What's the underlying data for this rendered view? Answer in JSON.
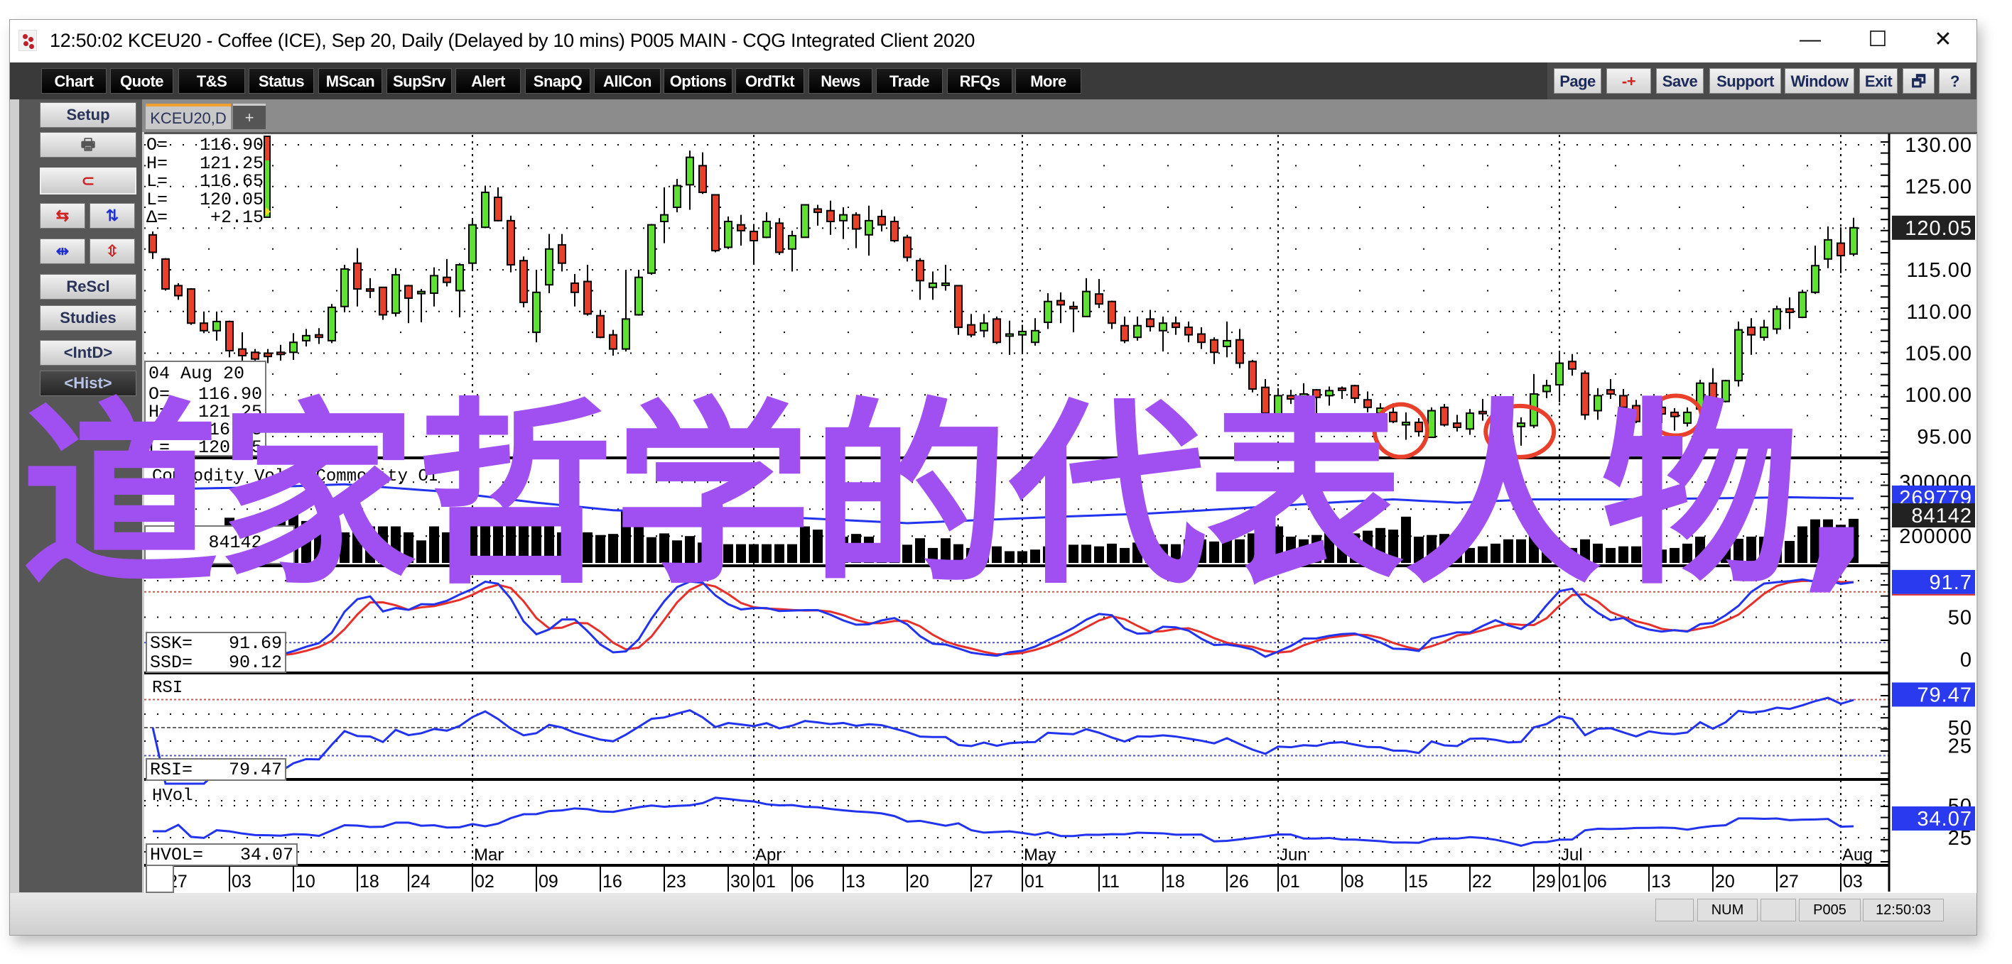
{
  "window": {
    "title": "12:50:02  KCEU20 - Coffee (ICE), Sep 20, Daily (Delayed by 10 mins)   P005 MAIN - CQG Integrated Client 2020",
    "minimize": "—",
    "maximize": "☐",
    "close": "✕"
  },
  "toolbar": {
    "left": [
      "Chart",
      "Quote",
      "T&S",
      "Status",
      "MScan",
      "SupSrv",
      "Alert",
      "SnapQ",
      "AllCon",
      "Options",
      "OrdTkt",
      "News",
      "Trade",
      "RFQs",
      "More"
    ],
    "right": [
      "Page",
      "-+",
      "Save",
      "Support",
      "Window",
      "Exit",
      "🗗",
      "?"
    ]
  },
  "sidebar": {
    "setup": "Setup",
    "print": "🖶",
    "magnet": "⊂",
    "rescl": "ReScl",
    "studies": "Studies",
    "intd": "<IntD>",
    "hist": "<Hist>",
    "arrows": [
      "⇆",
      "⇅",
      "⇹",
      "⇳"
    ]
  },
  "tabs": [
    {
      "label": "KCEU20,D"
    },
    {
      "label": "+"
    }
  ],
  "ohlc_readout": [
    {
      "k": "O=",
      "v": "116.90"
    },
    {
      "k": "H=",
      "v": "121.25"
    },
    {
      "k": "L=",
      "v": "116.65"
    },
    {
      "k": "L=",
      "v": "120.05"
    },
    {
      "k": "Δ=",
      "v": "+2.15"
    }
  ],
  "cursor_readout": {
    "date": "04 Aug 20",
    "rows": [
      {
        "k": "O=",
        "v": "116.90"
      },
      {
        "k": "H=",
        "v": "121.25"
      },
      {
        "k": "L=",
        "v": "116.65"
      },
      {
        "k": "L=",
        "v": "120.05"
      }
    ]
  },
  "panel_labels": {
    "volume": "Commodity Vol & Commodity OI",
    "vol_key": "Vol=",
    "vol_val": "84142",
    "rsi": "RSI",
    "hvol": "HVol"
  },
  "stoch_readout": [
    {
      "k": "SSK=",
      "v": "91.69"
    },
    {
      "k": "SSD=",
      "v": "90.12"
    }
  ],
  "rsi_readout": {
    "k": "RSI=",
    "v": "79.47"
  },
  "hvol_readout": {
    "k": "HVOL=",
    "v": "34.07"
  },
  "watermark": {
    "text": "道家哲学的代表人物,",
    "color": "#a050f0"
  },
  "status": {
    "num": "NUM",
    "page": "P005",
    "time": "12:50:03"
  },
  "colors": {
    "up": "#5ce22f",
    "down": "#e8402a",
    "line": "#2233ee",
    "signal": "#e8302a",
    "circle": "#e8402a"
  },
  "chart_data": {
    "type": "candlestick",
    "title": "KCEU20 - Coffee (ICE), Sep 20, Daily",
    "candles": [
      [
        119.2,
        119.6,
        116.3,
        117.1
      ],
      [
        116.3,
        116.4,
        112.5,
        112.7
      ],
      [
        113.1,
        113.4,
        111.4,
        111.9
      ],
      [
        112.7,
        112.8,
        108.4,
        108.6
      ],
      [
        108.6,
        110.0,
        107.4,
        107.7
      ],
      [
        107.7,
        110.0,
        106.5,
        108.8
      ],
      [
        108.8,
        108.9,
        104.5,
        105.3
      ],
      [
        105.5,
        107.5,
        104.0,
        104.7
      ],
      [
        105.1,
        105.5,
        103.7,
        104.3
      ],
      [
        105.0,
        105.5,
        103.8,
        104.6
      ],
      [
        105.1,
        106.0,
        104.1,
        104.9
      ],
      [
        105.1,
        107.4,
        104.2,
        106.3
      ],
      [
        106.5,
        107.9,
        105.8,
        107.1
      ],
      [
        107.2,
        108.0,
        106.1,
        106.9
      ],
      [
        106.5,
        110.9,
        106.2,
        110.5
      ],
      [
        110.6,
        115.6,
        109.9,
        115.1
      ],
      [
        115.8,
        117.6,
        110.6,
        112.7
      ],
      [
        112.7,
        114.0,
        111.6,
        112.5
      ],
      [
        112.9,
        112.9,
        109.0,
        109.6
      ],
      [
        109.8,
        115.2,
        109.4,
        114.4
      ],
      [
        113.1,
        113.2,
        108.6,
        111.6
      ],
      [
        112.2,
        112.7,
        108.7,
        112.4
      ],
      [
        112.2,
        115.3,
        110.6,
        114.3
      ],
      [
        114.1,
        116.3,
        113.0,
        113.5
      ],
      [
        112.5,
        115.8,
        109.3,
        115.6
      ],
      [
        115.8,
        121.1,
        114.9,
        120.4
      ],
      [
        120.1,
        125.1,
        120.0,
        124.3
      ],
      [
        123.7,
        124.9,
        120.8,
        120.9
      ],
      [
        120.9,
        121.5,
        114.7,
        115.6
      ],
      [
        116.1,
        116.6,
        110.5,
        111.1
      ],
      [
        107.5,
        115.0,
        106.3,
        112.3
      ],
      [
        113.2,
        119.3,
        112.2,
        117.5
      ],
      [
        118.0,
        119.3,
        114.8,
        115.8
      ],
      [
        113.4,
        114.5,
        110.6,
        112.3
      ],
      [
        113.6,
        115.6,
        109.5,
        109.7
      ],
      [
        109.5,
        110.2,
        106.8,
        106.9
      ],
      [
        107.2,
        107.8,
        104.7,
        105.5
      ],
      [
        105.5,
        115.0,
        105.2,
        109.1
      ],
      [
        109.6,
        115.0,
        109.5,
        114.1
      ],
      [
        114.6,
        120.5,
        114.4,
        120.4
      ],
      [
        120.8,
        124.9,
        118.2,
        121.6
      ],
      [
        122.5,
        125.9,
        121.9,
        125.1
      ],
      [
        125.2,
        129.3,
        122.2,
        128.5
      ],
      [
        127.5,
        129.1,
        124.1,
        124.3
      ],
      [
        124.0,
        124.0,
        117.1,
        117.3
      ],
      [
        117.7,
        121.4,
        117.5,
        120.8
      ],
      [
        120.4,
        121.6,
        117.9,
        119.7
      ],
      [
        119.6,
        120.5,
        115.8,
        118.5
      ],
      [
        118.9,
        121.9,
        118.8,
        120.8
      ],
      [
        120.6,
        121.2,
        116.8,
        117.1
      ],
      [
        117.5,
        119.7,
        114.8,
        119.1
      ],
      [
        118.9,
        122.8,
        118.9,
        122.8
      ],
      [
        122.3,
        122.8,
        120.3,
        121.9
      ],
      [
        122.1,
        123.3,
        119.2,
        120.8
      ],
      [
        120.9,
        122.5,
        118.7,
        121.6
      ],
      [
        121.6,
        121.9,
        117.6,
        119.9
      ],
      [
        119.2,
        122.7,
        116.7,
        120.9
      ],
      [
        121.4,
        122.2,
        119.6,
        120.4
      ],
      [
        120.8,
        121.4,
        118.3,
        118.5
      ],
      [
        118.9,
        119.2,
        116.0,
        116.5
      ],
      [
        116.1,
        116.4,
        111.4,
        113.7
      ],
      [
        112.9,
        114.8,
        111.4,
        113.4
      ],
      [
        113.4,
        115.6,
        112.5,
        113.4
      ],
      [
        113.1,
        113.1,
        107.2,
        108.1
      ],
      [
        108.4,
        109.7,
        106.9,
        107.2
      ],
      [
        107.7,
        109.7,
        106.9,
        108.6
      ],
      [
        109.1,
        109.4,
        106.1,
        106.3
      ],
      [
        107.2,
        108.9,
        104.8,
        107.3
      ],
      [
        107.2,
        108.4,
        104.9,
        107.6
      ],
      [
        106.3,
        109.2,
        105.9,
        107.7
      ],
      [
        108.7,
        112.2,
        107.9,
        111.2
      ],
      [
        111.3,
        112.3,
        108.6,
        110.8
      ],
      [
        110.6,
        111.2,
        107.5,
        110.5
      ],
      [
        109.4,
        114.0,
        109.4,
        112.4
      ],
      [
        112.1,
        113.9,
        110.4,
        110.9
      ],
      [
        111.2,
        111.3,
        107.9,
        108.6
      ],
      [
        108.3,
        109.4,
        106.2,
        106.5
      ],
      [
        106.9,
        109.4,
        106.5,
        108.3
      ],
      [
        109.1,
        110.2,
        107.6,
        108.2
      ],
      [
        107.7,
        109.4,
        105.2,
        108.6
      ],
      [
        108.6,
        109.4,
        107.2,
        108.1
      ],
      [
        108.1,
        108.8,
        106.3,
        107.2
      ],
      [
        107.3,
        108.1,
        105.5,
        106.3
      ],
      [
        106.6,
        106.9,
        103.7,
        105.1
      ],
      [
        105.8,
        108.8,
        104.5,
        106.5
      ],
      [
        106.6,
        107.9,
        103.2,
        103.8
      ],
      [
        104.0,
        104.2,
        100.3,
        100.7
      ],
      [
        100.9,
        101.9,
        97.6,
        97.8
      ],
      [
        97.6,
        100.8,
        96.3,
        99.9
      ],
      [
        99.9,
        100.6,
        98.9,
        99.5
      ],
      [
        100.1,
        101.4,
        99.3,
        100.1
      ],
      [
        100.6,
        100.7,
        96.5,
        99.7
      ],
      [
        99.9,
        101.0,
        98.7,
        100.5
      ],
      [
        100.8,
        101.0,
        99.5,
        100.7
      ],
      [
        101.1,
        101.2,
        99.0,
        99.6
      ],
      [
        99.4,
        100.4,
        97.9,
        98.5
      ],
      [
        97.8,
        99.0,
        97.2,
        98.4
      ],
      [
        97.9,
        99.0,
        96.6,
        96.8
      ],
      [
        96.4,
        97.9,
        94.6,
        96.7
      ],
      [
        96.7,
        97.2,
        95.0,
        95.6
      ],
      [
        94.9,
        98.5,
        94.9,
        98.1
      ],
      [
        98.5,
        98.9,
        96.2,
        96.4
      ],
      [
        96.6,
        97.6,
        95.6,
        96.1
      ],
      [
        95.9,
        98.3,
        95.2,
        97.8
      ],
      [
        98.0,
        99.5,
        96.9,
        97.9
      ],
      [
        98.0,
        100.0,
        96.0,
        97.4
      ],
      [
        97.4,
        98.0,
        95.9,
        96.5
      ],
      [
        96.2,
        97.3,
        93.9,
        96.6
      ],
      [
        96.3,
        102.5,
        96.0,
        100.1
      ],
      [
        100.4,
        101.8,
        99.6,
        101.1
      ],
      [
        101.2,
        105.3,
        99.1,
        103.8
      ],
      [
        104.0,
        104.9,
        102.3,
        103.1
      ],
      [
        102.6,
        102.9,
        97.0,
        97.6
      ],
      [
        98.1,
        100.8,
        97.0,
        99.9
      ],
      [
        100.6,
        101.9,
        99.5,
        100.1
      ],
      [
        99.9,
        100.7,
        98.1,
        98.5
      ],
      [
        98.7,
        99.4,
        96.6,
        96.8
      ],
      [
        97.7,
        98.8,
        97.0,
        98.5
      ],
      [
        98.5,
        99.5,
        96.6,
        97.7
      ],
      [
        97.9,
        98.4,
        95.7,
        97.4
      ],
      [
        96.6,
        98.5,
        96.2,
        97.9
      ],
      [
        98.3,
        101.8,
        97.7,
        101.4
      ],
      [
        101.4,
        103.2,
        98.9,
        99.1
      ],
      [
        99.2,
        101.8,
        99.1,
        101.7
      ],
      [
        101.7,
        108.8,
        101.0,
        107.8
      ],
      [
        108.1,
        109.2,
        104.8,
        107.2
      ],
      [
        106.9,
        109.0,
        106.5,
        108.1
      ],
      [
        107.9,
        110.7,
        107.3,
        110.3
      ],
      [
        110.3,
        111.7,
        107.9,
        109.9
      ],
      [
        109.3,
        112.6,
        109.2,
        112.3
      ],
      [
        112.3,
        117.9,
        112.1,
        115.5
      ],
      [
        116.3,
        120.2,
        115.2,
        118.6
      ],
      [
        118.2,
        120.1,
        114.6,
        116.7
      ],
      [
        116.9,
        121.25,
        116.65,
        120.05
      ]
    ],
    "volume_k": [
      200,
      195,
      205,
      190,
      200,
      210,
      234,
      223,
      237,
      238,
      238,
      261,
      228,
      220,
      224,
      207,
      225,
      218,
      218,
      218,
      207,
      192,
      218,
      207,
      240,
      234,
      252,
      220,
      224,
      220,
      234,
      220,
      207,
      207,
      207,
      202,
      204,
      246,
      220,
      198,
      205,
      192,
      200,
      188,
      190,
      185,
      185,
      185,
      185,
      185,
      185,
      218,
      212,
      205,
      199,
      204,
      199,
      187,
      184,
      184,
      196,
      178,
      196,
      185,
      178,
      181,
      181,
      172,
      172,
      175,
      181,
      184,
      184,
      184,
      181,
      186,
      178,
      188,
      178,
      185,
      185,
      194,
      194,
      190,
      200,
      194,
      205,
      210,
      218,
      199,
      194,
      202,
      207,
      215,
      205,
      210,
      215,
      212,
      236,
      199,
      202,
      204,
      204,
      178,
      181,
      186,
      194,
      194,
      221,
      191,
      181,
      178,
      194,
      186,
      178,
      181,
      181,
      180,
      175,
      178,
      186,
      199,
      185,
      188,
      195,
      199,
      199,
      192,
      191,
      218,
      231,
      231,
      221,
      232
    ],
    "open_interest_k": [
      [
        0,
        287
      ],
      [
        8,
        290
      ],
      [
        15,
        296
      ],
      [
        23,
        282
      ],
      [
        30,
        262
      ],
      [
        36,
        248
      ],
      [
        45,
        240
      ],
      [
        52,
        232
      ],
      [
        59,
        224
      ],
      [
        65,
        230
      ],
      [
        70,
        235
      ],
      [
        78,
        242
      ],
      [
        86,
        253
      ],
      [
        92,
        262
      ],
      [
        97,
        268
      ],
      [
        102,
        262
      ],
      [
        108,
        268
      ],
      [
        115,
        268
      ],
      [
        122,
        270
      ],
      [
        128,
        272
      ],
      [
        133,
        270
      ]
    ],
    "price_axis": {
      "ticks": [
        "130.00",
        "125.00",
        "120.00",
        "115.00",
        "110.00",
        "105.00",
        "100.00",
        "95.00"
      ],
      "last": "120.05"
    },
    "volume_axis": {
      "ticks": [
        "300000",
        "200000"
      ],
      "oi_last": "269779",
      "vol_last": "84142"
    },
    "stoch_axis": {
      "ticks": [
        "50",
        "0"
      ],
      "last": "91.7",
      "upper": 80,
      "lower": 20
    },
    "rsi_axis": {
      "ticks": [
        "50",
        "25"
      ],
      "last": "79.47",
      "upper": 75,
      "lower": 25
    },
    "hvol_axis": {
      "ticks": [
        "50",
        "25"
      ],
      "last": "34.07"
    },
    "x_dates": [
      {
        "i": 1,
        "label": "27"
      },
      {
        "i": 6,
        "label": "03"
      },
      {
        "i": 11,
        "label": "10"
      },
      {
        "i": 16,
        "label": "18"
      },
      {
        "i": 20,
        "label": "24"
      },
      {
        "i": 25,
        "label": "02"
      },
      {
        "i": 30,
        "label": "09"
      },
      {
        "i": 35,
        "label": "16"
      },
      {
        "i": 40,
        "label": "23"
      },
      {
        "i": 45,
        "label": "30"
      },
      {
        "i": 47,
        "label": "01"
      },
      {
        "i": 50,
        "label": "06"
      },
      {
        "i": 54,
        "label": "13"
      },
      {
        "i": 59,
        "label": "20"
      },
      {
        "i": 64,
        "label": "27"
      },
      {
        "i": 68,
        "label": "01"
      },
      {
        "i": 74,
        "label": "11"
      },
      {
        "i": 79,
        "label": "18"
      },
      {
        "i": 84,
        "label": "26"
      },
      {
        "i": 88,
        "label": "01"
      },
      {
        "i": 93,
        "label": "08"
      },
      {
        "i": 98,
        "label": "15"
      },
      {
        "i": 103,
        "label": "22"
      },
      {
        "i": 108,
        "label": "29"
      },
      {
        "i": 110,
        "label": "01"
      },
      {
        "i": 112,
        "label": "06"
      },
      {
        "i": 117,
        "label": "13"
      },
      {
        "i": 122,
        "label": "20"
      },
      {
        "i": 127,
        "label": "27"
      },
      {
        "i": 132,
        "label": "03"
      }
    ],
    "months": [
      {
        "i": 25,
        "label": "Mar"
      },
      {
        "i": 47,
        "label": "Apr"
      },
      {
        "i": 68,
        "label": "May"
      },
      {
        "i": 88,
        "label": "Jun"
      },
      {
        "i": 110,
        "label": "Jul"
      },
      {
        "i": 132,
        "label": "Aug"
      }
    ],
    "highlight_circles": [
      {
        "i": 97.6,
        "price": 95.7
      },
      {
        "i": 106.9,
        "price": 95.6
      },
      {
        "i": 119.1,
        "price": 97.5
      }
    ]
  }
}
